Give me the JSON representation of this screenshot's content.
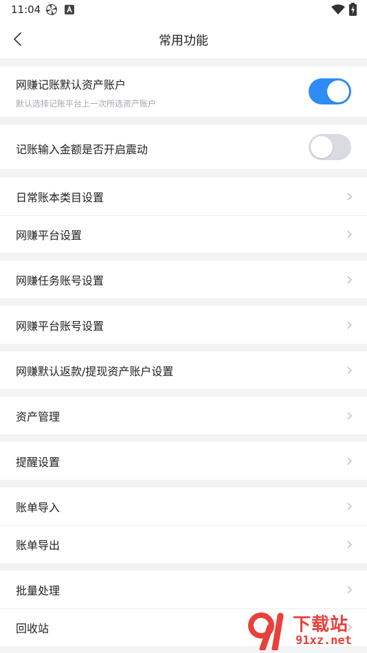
{
  "status_bar": {
    "time": "11:04",
    "icons": [
      "pinwheel-icon",
      "a-badge-icon",
      "wifi-icon",
      "battery-charging-icon"
    ]
  },
  "nav": {
    "title": "常用功能",
    "back_icon": "chevron-left-icon"
  },
  "settings": {
    "toggle_asset_account": {
      "label": "网赚记账默认资产账户",
      "subtitle": "默认选择记账平台上一次所选资产账户",
      "on": true
    },
    "toggle_vibrate": {
      "label": "记账输入金额是否开启震动",
      "on": false
    },
    "daily_category": "日常账本类目设置",
    "platform_settings": "网赚平台设置",
    "task_account": "网赚任务账号设置",
    "platform_account": "网赚平台账号设置",
    "default_refund_account": "网赚默认返款/提现资产账户设置",
    "asset_management": "资产管理",
    "reminder": "提醒设置",
    "bill_import": "账单导入",
    "bill_export": "账单导出",
    "batch_process": "批量处理",
    "recycle_bin": "回收站"
  },
  "watermark": {
    "text": "下载站",
    "url": "91xz.net"
  },
  "colors": {
    "accent": "#2f8cf6",
    "toggle_off": "#d9dbe0",
    "background": "#f2f3f5",
    "watermark": "#e8413b"
  }
}
